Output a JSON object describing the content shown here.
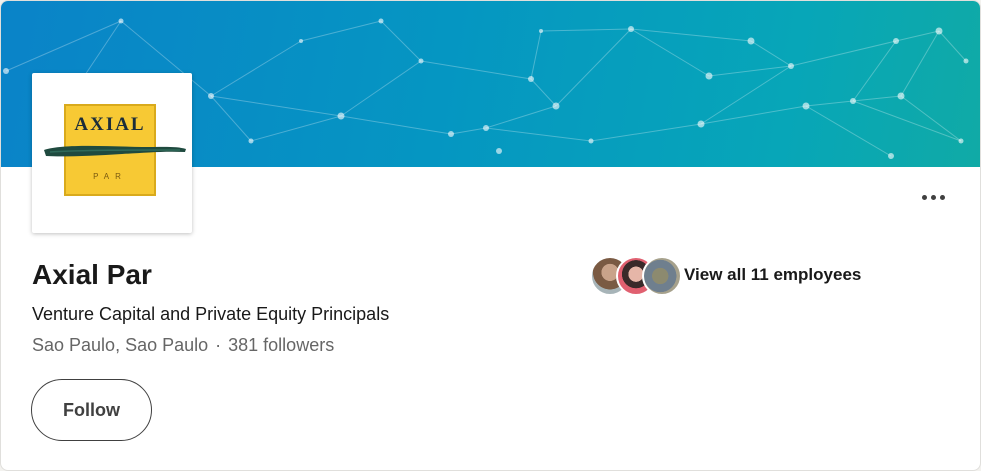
{
  "company": {
    "name": "Axial Par",
    "tagline": "Venture Capital and Private Equity Principals",
    "location": "Sao Paulo, Sao Paulo",
    "separator": "·",
    "followers": "381 followers"
  },
  "logo": {
    "wordmark": "AXIAL",
    "sub": "PAR",
    "colors": {
      "yellow": "#f7c934",
      "stroke": "#1f4a3f"
    }
  },
  "actions": {
    "follow_label": "Follow",
    "more_icon": "more-horizontal-icon"
  },
  "employees": {
    "label": "View all 11 employees",
    "avatar_count": 3
  },
  "colors": {
    "banner_start": "#0a83c8",
    "banner_end": "#10aaa6",
    "text_primary": "#191919",
    "text_secondary": "#666666"
  }
}
